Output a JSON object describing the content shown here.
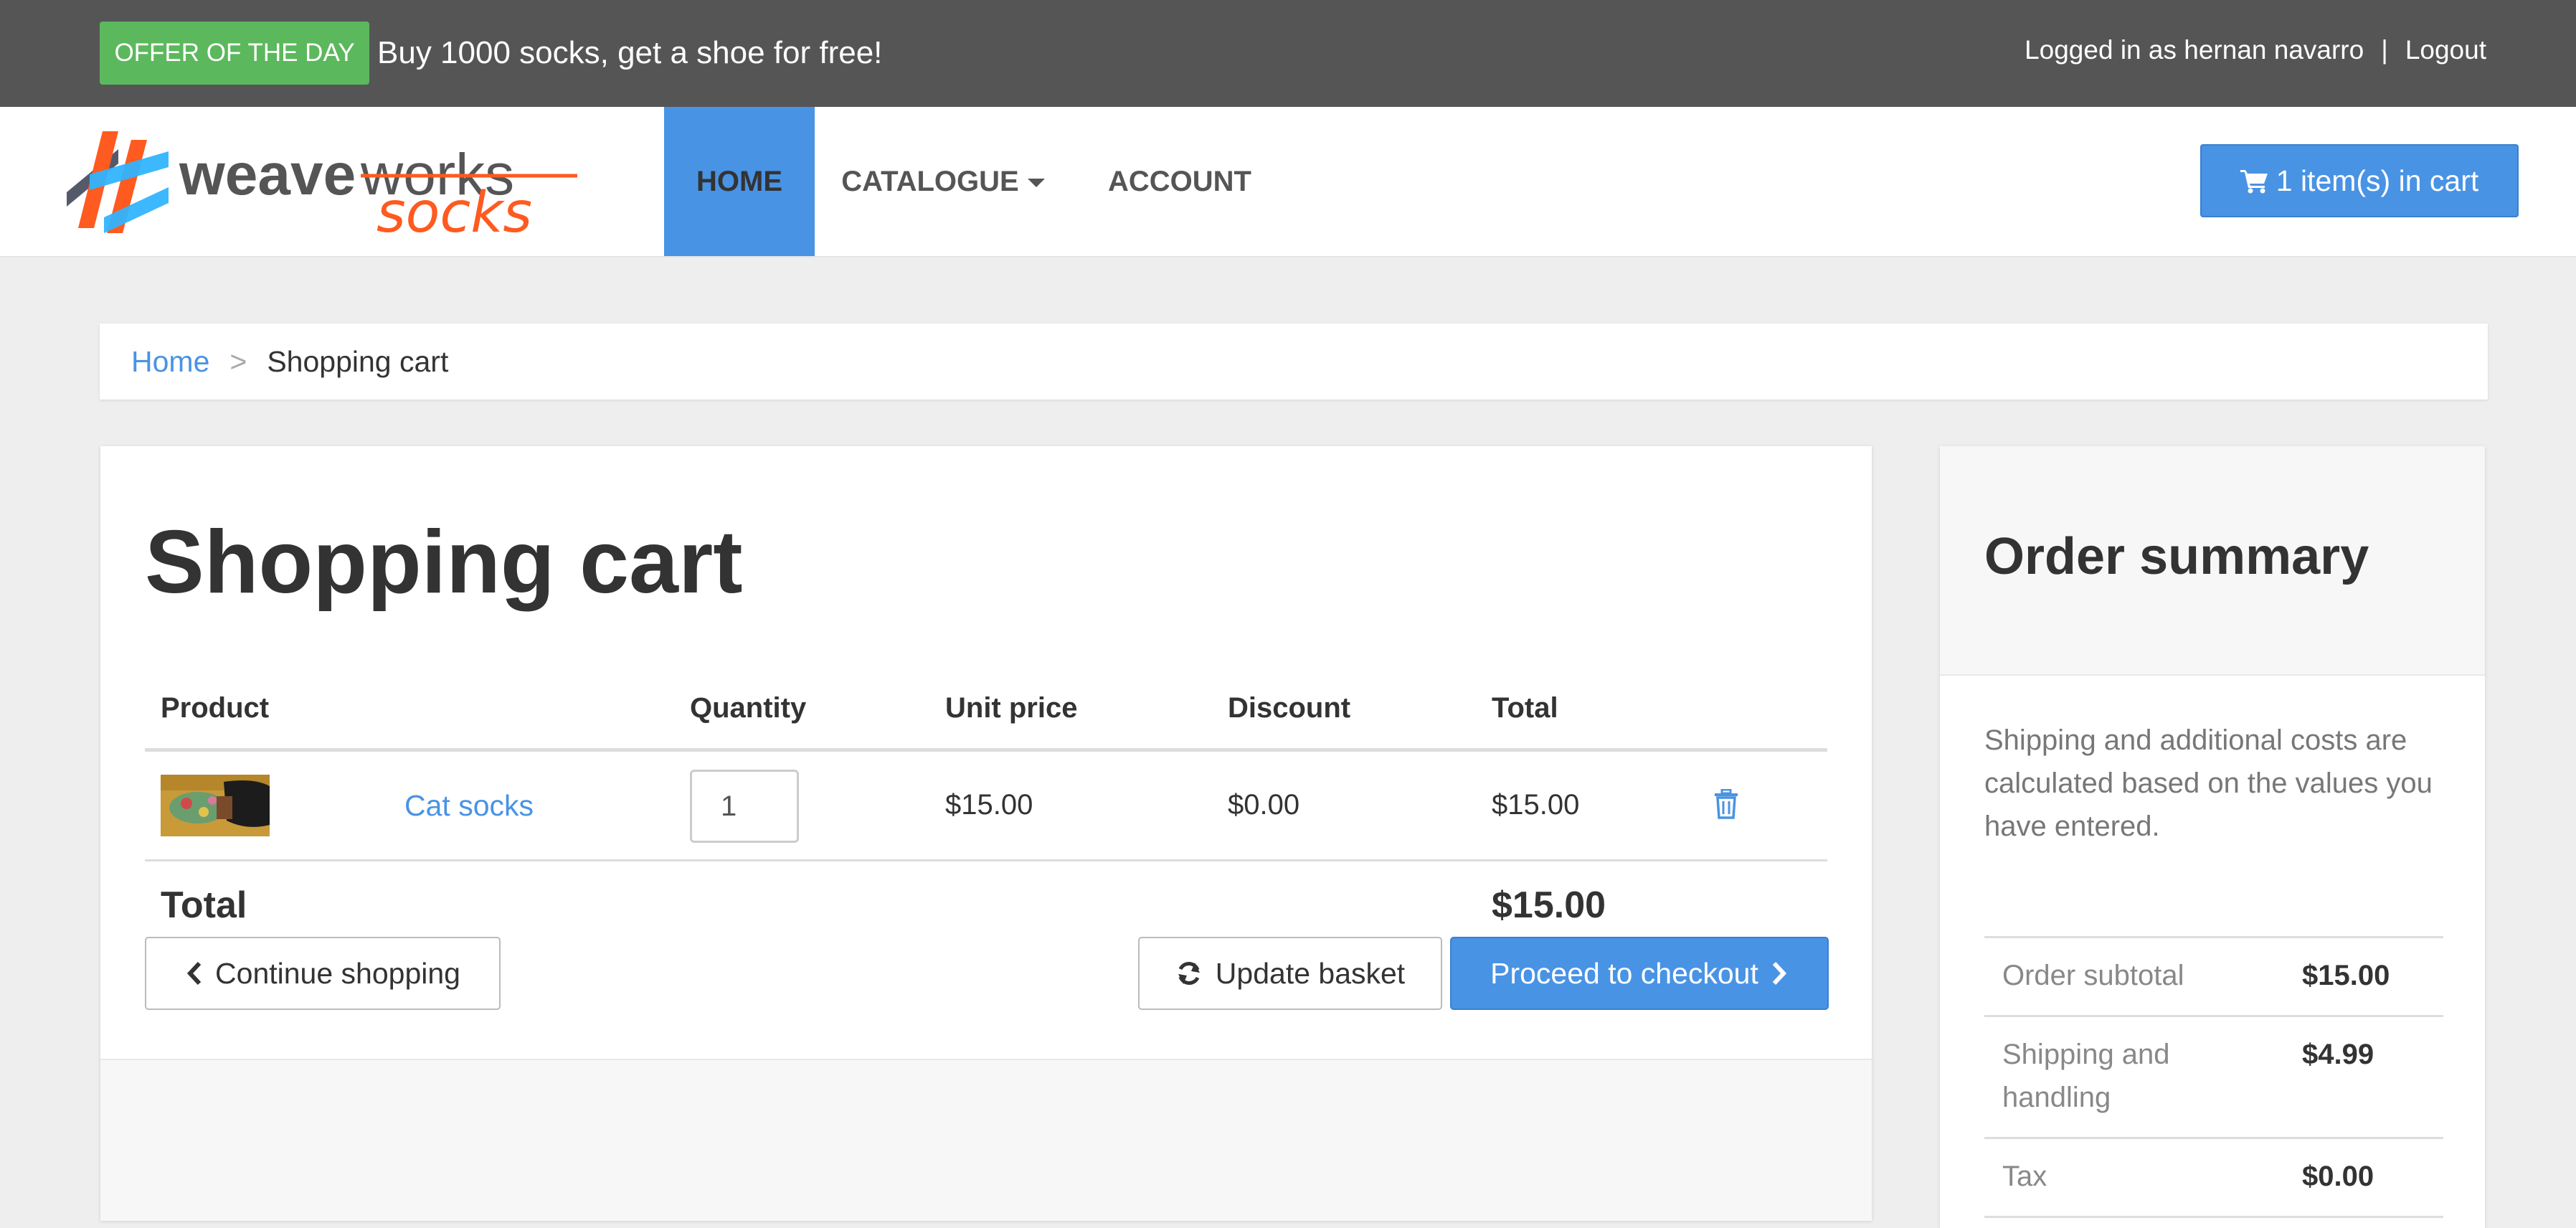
{
  "topbar": {
    "offer_badge": "OFFER OF THE DAY",
    "offer_text": "Buy 1000 socks, get a shoe for free!",
    "logged_in_text": "Logged in as hernan navarro",
    "separator": "|",
    "logout_label": "Logout"
  },
  "navbar": {
    "logo": {
      "weave": "weave",
      "works": "works",
      "socks": "socks"
    },
    "items": [
      {
        "label": "HOME",
        "active": true
      },
      {
        "label": "CATALOGUE",
        "has_dropdown": true
      },
      {
        "label": "ACCOUNT"
      }
    ],
    "cart_button_label": "1 item(s) in cart",
    "cart_icon": "shopping-cart-icon"
  },
  "breadcrumb": {
    "home": "Home",
    "separator": ">",
    "current": "Shopping cart"
  },
  "cart": {
    "title": "Shopping cart",
    "columns": {
      "product": "Product",
      "quantity": "Quantity",
      "unit_price": "Unit price",
      "discount": "Discount",
      "total": "Total"
    },
    "rows": [
      {
        "product_name": "Cat socks",
        "quantity": "1",
        "unit_price": "$15.00",
        "discount": "$0.00",
        "total": "$15.00",
        "remove_icon": "trash-icon"
      }
    ],
    "total_label": "Total",
    "total_value": "$15.00",
    "buttons": {
      "continue": "Continue shopping",
      "update": "Update basket",
      "checkout": "Proceed to checkout"
    }
  },
  "summary": {
    "title": "Order summary",
    "note": "Shipping and additional costs are calculated based on the values you have entered.",
    "rows": [
      {
        "label": "Order subtotal",
        "value": "$15.00"
      },
      {
        "label": "Shipping and handling",
        "value": "$4.99"
      },
      {
        "label": "Tax",
        "value": "$0.00"
      }
    ]
  },
  "colors": {
    "accent_blue": "#4993e4",
    "offer_green": "#5cb85c",
    "topbar_gray": "#555555",
    "logo_orange": "#ff5a1f"
  }
}
